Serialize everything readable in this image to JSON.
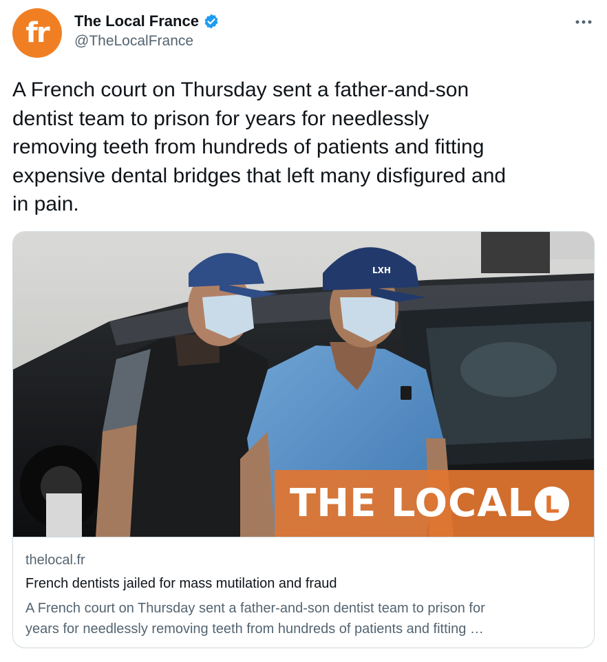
{
  "author": {
    "avatar_text": "fr",
    "display_name": "The Local France",
    "handle": "@TheLocalFrance",
    "verified": true
  },
  "tweet": {
    "text_lines": [
      "A French court on Thursday sent a father-and-son",
      "dentist team to prison for years for needlessly",
      "removing teeth from hundreds of patients and fitting",
      "expensive dental bridges that left many disfigured and",
      "in pain."
    ]
  },
  "card": {
    "image_brand_text": "THE LOCAL",
    "image_brand_logo_letter": "L",
    "cap_logo_text": "LXH",
    "domain": "thelocal.fr",
    "title": "French dentists jailed for mass mutilation and fraud",
    "description_lines": [
      "A French court on Thursday sent a father-and-son dentist team to prison for",
      "years for needlessly removing teeth from hundreds of patients and fitting …"
    ]
  },
  "icons": {
    "verified": "verified-badge-icon",
    "more": "more-options-icon"
  },
  "colors": {
    "avatar_bg": "#f07f24",
    "verified_blue": "#1d9bf0",
    "secondary_text": "#536471",
    "brand_orange": "#e27530",
    "card_border": "#cfd9de"
  }
}
